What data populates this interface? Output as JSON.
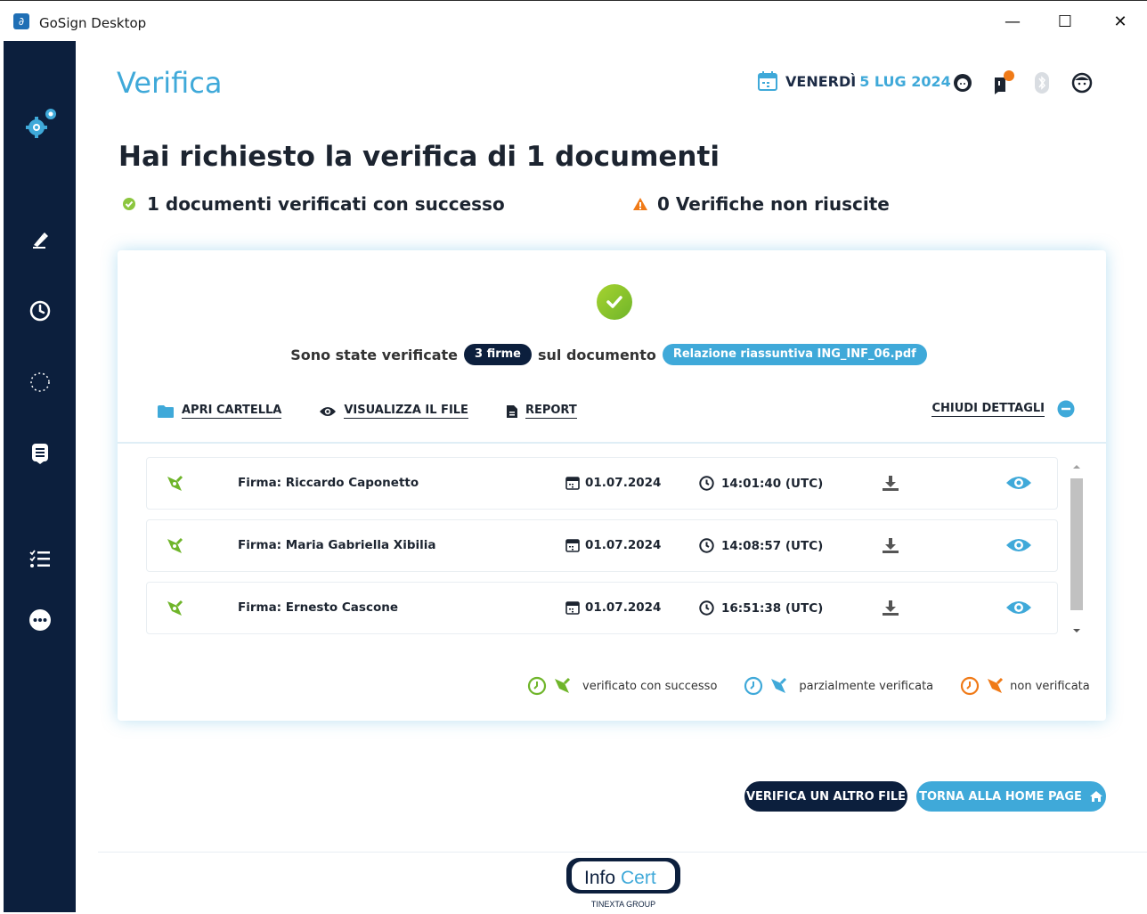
{
  "window": {
    "title": "GoSign Desktop",
    "minimize": "—",
    "maximize": "☐",
    "close": "✕"
  },
  "header": {
    "title": "Verifica",
    "day": "VENERDÌ",
    "date": "5 LUG 2024"
  },
  "summary": {
    "headline": "Hai richiesto la verifica di 1 documenti",
    "success_text": "1 documenti verificati con successo",
    "fail_text": "0 Verifiche non riuscite"
  },
  "card": {
    "verified_prefix": "Sono state verificate",
    "signatures_badge": "3 firme",
    "verified_middle": "sul documento",
    "document_badge": "Relazione riassuntiva ING_INF_06.pdf",
    "actions": {
      "open_folder": "APRI CARTELLA",
      "view_file": "VISUALIZZA IL FILE",
      "report": "REPORT",
      "close_details": "CHIUDI DETTAGLI"
    },
    "signatures": [
      {
        "name": "Firma: Riccardo Caponetto",
        "date": "01.07.2024",
        "time": "14:01:40 (UTC)",
        "status": "verificato con successo"
      },
      {
        "name": "Firma: Maria Gabriella Xibilia",
        "date": "01.07.2024",
        "time": "14:08:57 (UTC)",
        "status": "verificato con successo"
      },
      {
        "name": "Firma: Ernesto Cascone",
        "date": "01.07.2024",
        "time": "16:51:38 (UTC)",
        "status": "verificato con successo"
      }
    ],
    "legend": {
      "success": "verificato con successo",
      "partial": "parzialmente verificata",
      "failed": "non verificata"
    }
  },
  "buttons": {
    "verify_other": "VERIFICA UN ALTRO FILE",
    "home": "TORNA ALLA HOME PAGE"
  },
  "footer": {
    "brand_info": "Info",
    "brand_cert": "Cert",
    "group": "TINEXTA GROUP"
  },
  "colors": {
    "sidebar": "#0c1f3d",
    "accent": "#3fa9d9",
    "success": "#6fb52a",
    "partial": "#3fa9d9",
    "failed": "#f07a17",
    "warning": "#f07a17"
  },
  "sidebar_icons": [
    "gear-icon",
    "pen-sign-icon",
    "clock-icon",
    "loading-icon",
    "document-list-icon",
    "checklist-icon",
    "more-icon"
  ]
}
